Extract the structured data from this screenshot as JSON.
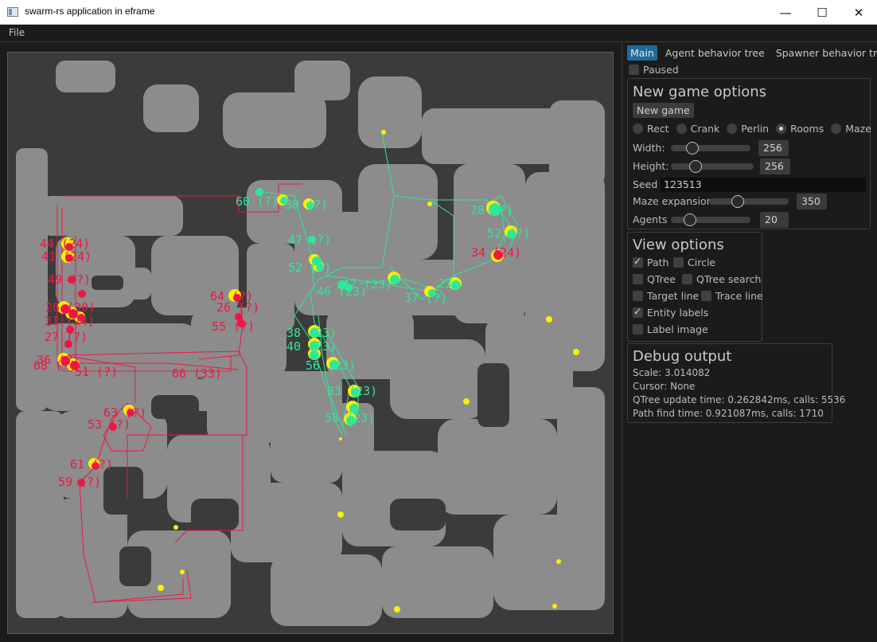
{
  "window": {
    "title": "swarm-rs application in eframe",
    "minimize": "—",
    "maximize": "☐",
    "close": "✕"
  },
  "menu": {
    "file": "File"
  },
  "tabs": [
    {
      "label": "Main",
      "active": true
    },
    {
      "label": "Agent behavior tree",
      "active": false
    },
    {
      "label": "Spawner behavior tree",
      "active": false
    }
  ],
  "paused": {
    "label": "Paused",
    "checked": false
  },
  "new_game": {
    "title": "New game options",
    "button": "New game",
    "map_types": [
      {
        "label": "Rect",
        "selected": false
      },
      {
        "label": "Crank",
        "selected": false
      },
      {
        "label": "Perlin",
        "selected": false
      },
      {
        "label": "Rooms",
        "selected": true
      },
      {
        "label": "Maze",
        "selected": false
      }
    ],
    "width": {
      "label": "Width:",
      "value": "256",
      "fraction": 0.28
    },
    "height": {
      "label": "Height:",
      "value": "256",
      "fraction": 0.32
    },
    "seed": {
      "label": "Seed",
      "value": "123513"
    },
    "maze_expansion": {
      "label": "Maze expansion",
      "value": "350",
      "fraction": 0.35
    },
    "agents": {
      "label": "Agents",
      "value": "20",
      "fraction": 0.24
    }
  },
  "view_options": {
    "title": "View options",
    "items": [
      {
        "label": "Path",
        "checked": true
      },
      {
        "label": "Circle",
        "checked": false
      },
      {
        "label": "QTree",
        "checked": false
      },
      {
        "label": "QTree search",
        "checked": false
      },
      {
        "label": "Target line",
        "checked": false
      },
      {
        "label": "Trace line",
        "checked": false
      },
      {
        "label": "Entity labels",
        "checked": true
      },
      {
        "label": "Label image",
        "checked": false
      }
    ]
  },
  "debug": {
    "title": "Debug output",
    "lines": [
      "Scale: 3.014082",
      "Cursor: None",
      "QTree update time: 0.262842ms, calls: 5536",
      "Path find time: 0.921087ms, calls: 1710"
    ]
  },
  "colors": {
    "red_team": "#ee1744",
    "green_team": "#2ee89a",
    "highlight": "#ffee00",
    "floor": "#8c8c8c",
    "wall": "#3b3b3b"
  },
  "map": {
    "red_labels": [
      {
        "text": "44 (24)"
      },
      {
        "text": "41 (24)"
      },
      {
        "text": "49 (?)"
      },
      {
        "text": "26 (30)"
      },
      {
        "text": "31 (24)"
      },
      {
        "text": "27 (?)"
      },
      {
        "text": "36 (?)"
      },
      {
        "text": "68 (?)"
      },
      {
        "text": "51 (?)"
      },
      {
        "text": "66 (33)"
      },
      {
        "text": "64 (?)"
      },
      {
        "text": "26 (?)"
      },
      {
        "text": "55 (?)"
      },
      {
        "text": "63 (?)"
      },
      {
        "text": "53 (?)"
      },
      {
        "text": "61 (?)"
      },
      {
        "text": "59 (?)"
      },
      {
        "text": "34 (24)"
      }
    ],
    "green_labels": [
      {
        "text": "60 (?)"
      },
      {
        "text": "30 (?)"
      },
      {
        "text": "47 (?)"
      },
      {
        "text": "52 (?)"
      },
      {
        "text": "46 (23)"
      },
      {
        "text": "42 (23)"
      },
      {
        "text": "38 (23)"
      },
      {
        "text": "40 (23)"
      },
      {
        "text": "56 (23)"
      },
      {
        "text": "33 (23)"
      },
      {
        "text": "58 (23)"
      },
      {
        "text": "28 (?)"
      },
      {
        "text": "52 (?)"
      },
      {
        "text": "37 (?)"
      },
      {
        "text": "23"
      }
    ]
  }
}
